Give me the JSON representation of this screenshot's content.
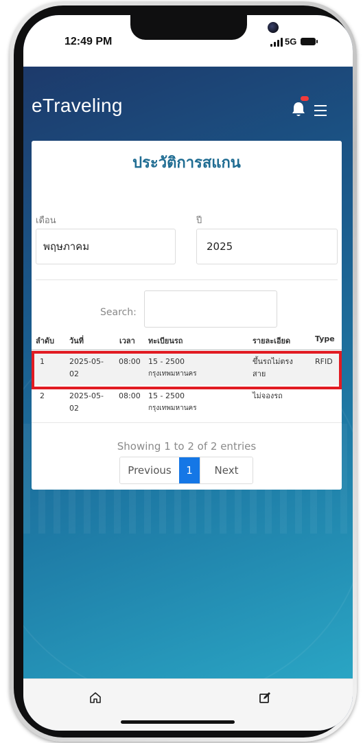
{
  "status_bar": {
    "time": "12:49 PM",
    "network": "5G"
  },
  "header": {
    "title": "eTraveling",
    "icons": {
      "notification": "bell-icon",
      "menu": "hamburger-menu-icon"
    },
    "badge_color": "#f13a3a"
  },
  "card": {
    "title": "ประวัติการสแกน",
    "month": {
      "label": "เดือน",
      "value": "พฤษภาคม"
    },
    "year": {
      "label": "ปี",
      "value": "2025"
    },
    "search": {
      "label": "Search:",
      "value": ""
    },
    "table": {
      "columns": [
        "ลำดับ",
        "วันที่",
        "เวลา",
        "ทะเบียนรถ",
        "รายละเอียด",
        "Type"
      ],
      "rows": [
        {
          "no": "1",
          "date_1": "2025-05-",
          "date_2": "02",
          "time": "08:00",
          "plate_1": "15 - 2500",
          "plate_2": "กรุงเทพมหานคร",
          "detail_1": "ขึ้นรถไม่ตรง",
          "detail_2": "สาย",
          "type": "RFID"
        },
        {
          "no": "2",
          "date_1": "2025-05-",
          "date_2": "02",
          "time": "08:00",
          "plate_1": "15 - 2500",
          "plate_2": "กรุงเทพมหานคร",
          "detail_1": "ไม่จองรถ",
          "detail_2": "",
          "type": ""
        }
      ]
    },
    "info": "Showing 1 to 2 of 2 entries",
    "pagination": {
      "previous": "Previous",
      "current": "1",
      "next": "Next"
    }
  },
  "bottom_nav": {
    "items": [
      "home-icon",
      "edit-icon"
    ]
  },
  "colors": {
    "accent": "#1577e6",
    "title": "#1f6c92",
    "highlight": "#e11b22"
  }
}
